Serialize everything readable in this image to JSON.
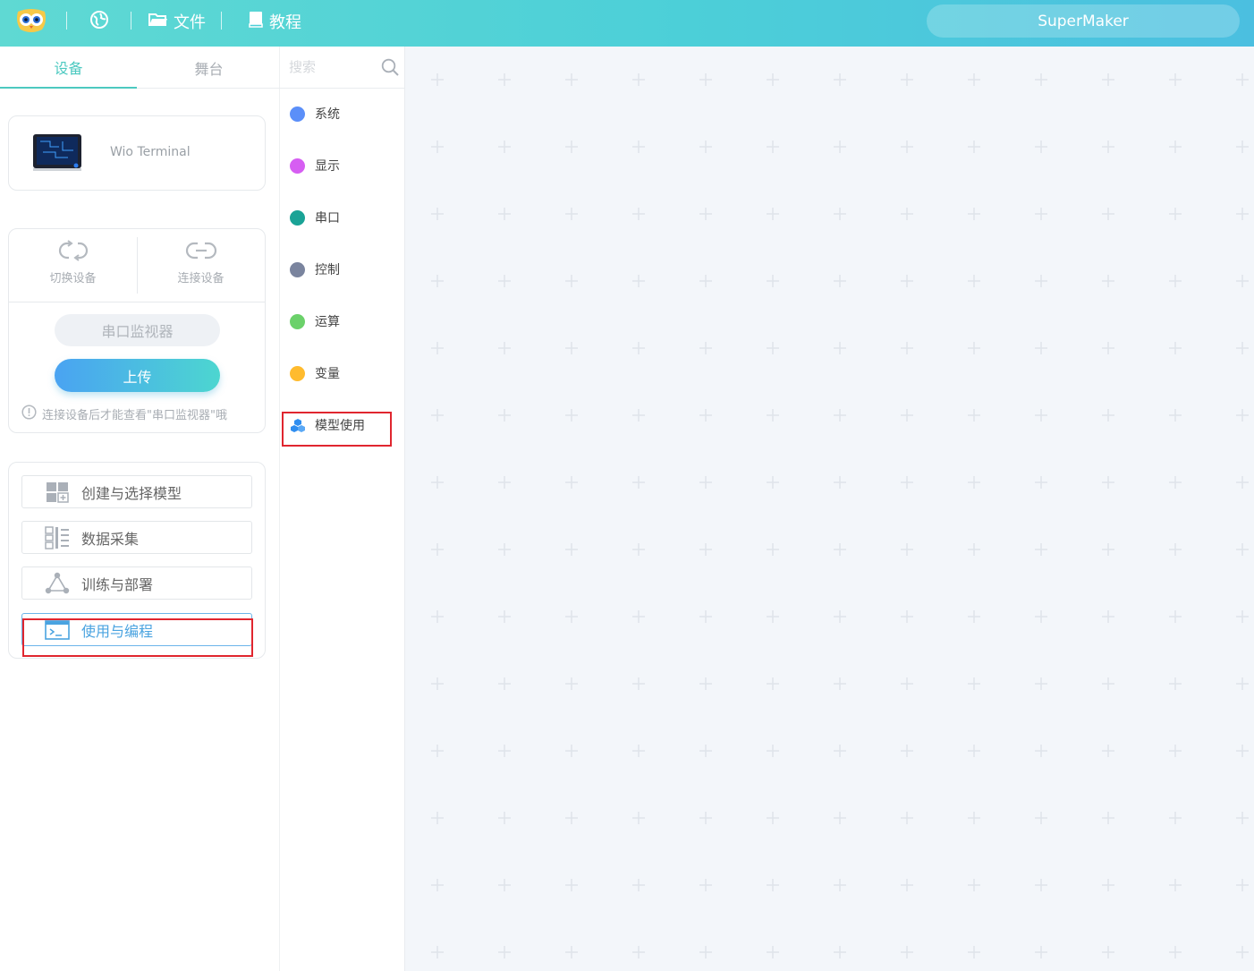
{
  "topbar": {
    "menu": [
      {
        "label": "",
        "icon": "globe-icon"
      },
      {
        "label": "文件",
        "icon": "folder-icon"
      },
      {
        "label": "教程",
        "icon": "book-icon"
      }
    ],
    "account_label": "SuperMaker"
  },
  "left_panel": {
    "tabs": [
      {
        "label": "设备",
        "active": true
      },
      {
        "label": "舞台",
        "active": false
      }
    ],
    "device": {
      "name": "Wio Terminal"
    },
    "controls": {
      "switch_label": "切换设备",
      "connect_label": "连接设备",
      "serial_monitor_label": "串口监视器",
      "upload_label": "上传",
      "hint": "连接设备后才能查看\"串口监视器\"哦"
    },
    "model_menu": [
      {
        "label": "创建与选择模型",
        "icon": "grid-add-icon"
      },
      {
        "label": "数据采集",
        "icon": "data-list-icon"
      },
      {
        "label": "训练与部署",
        "icon": "network-icon"
      },
      {
        "label": "使用与编程",
        "icon": "terminal-icon",
        "selected": true
      }
    ]
  },
  "categories": {
    "search_placeholder": "搜索",
    "items": [
      {
        "label": "系统",
        "color": "#5b8ff9"
      },
      {
        "label": "显示",
        "color": "#d65ef2"
      },
      {
        "label": "串口",
        "color": "#1aa396"
      },
      {
        "label": "控制",
        "color": "#7a849e"
      },
      {
        "label": "运算",
        "color": "#6bd16a"
      },
      {
        "label": "变量",
        "color": "#ffbb2e"
      },
      {
        "label": "模型使用",
        "icon": "cubes-icon",
        "color": "#2f8ef0"
      }
    ]
  },
  "colors": {
    "accent": "#4cc9c0",
    "highlight_box": "#e0262f",
    "workspace_bg": "#f3f6fa"
  }
}
